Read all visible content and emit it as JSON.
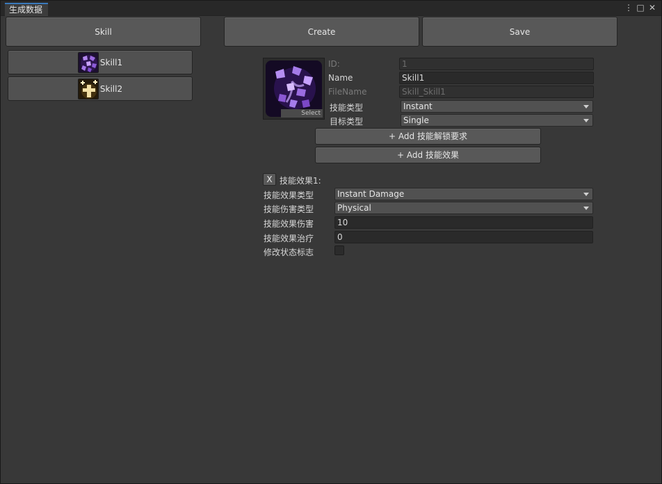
{
  "window": {
    "tab_title": "生成数据",
    "menu_glyph": "⋮",
    "maximize_glyph": "□",
    "close_glyph": "✕"
  },
  "toolbar": {
    "skill_label": "Skill",
    "create_label": "Create",
    "save_label": "Save"
  },
  "skill_list": [
    {
      "label": "Skill1",
      "icon": "purple-crystal-icon"
    },
    {
      "label": "Skill2",
      "icon": "gold-cross-icon"
    }
  ],
  "detail": {
    "icon": "purple-crystal-icon",
    "select_label": "Select",
    "id_label": "ID:",
    "id_value": "1",
    "name_label": "Name",
    "name_value": "Skill1",
    "filename_label": "FileName",
    "filename_value": "Skill_Skill1",
    "skill_type_label": "技能类型",
    "skill_type_value": "Instant",
    "target_type_label": "目标类型",
    "target_type_value": "Single",
    "add_unlock_label": "+ Add 技能解锁要求",
    "add_effect_label": "+ Add 技能效果"
  },
  "effect": {
    "remove_label": "X",
    "title": "技能效果1:",
    "effect_type_label": "技能效果类型",
    "effect_type_value": "Instant Damage",
    "damage_type_label": "技能伤害类型",
    "damage_type_value": "Physical",
    "damage_label": "技能效果伤害",
    "damage_value": "10",
    "heal_label": "技能效果治疗",
    "heal_value": "0",
    "modify_flag_label": "修改状态标志",
    "modify_flag_checked": false
  },
  "colors": {
    "tab_accent": "#3a79bb",
    "panel_bg": "#383838",
    "button_bg": "#585858"
  }
}
